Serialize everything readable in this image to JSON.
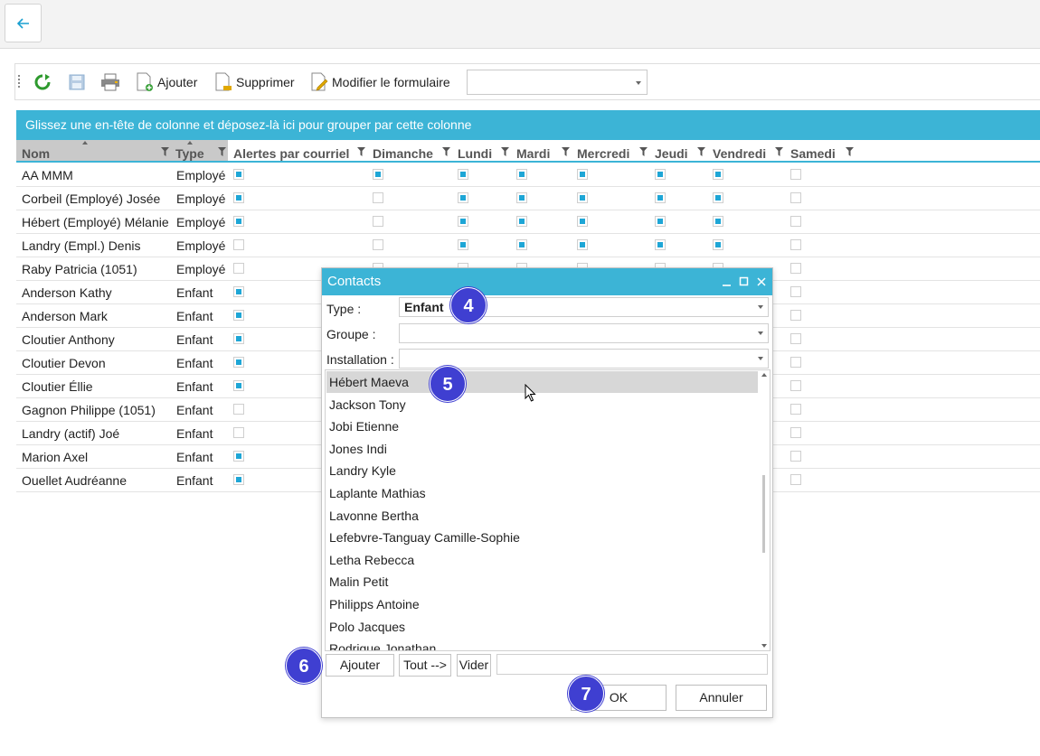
{
  "toolbar": {
    "add_label": "Ajouter",
    "delete_label": "Supprimer",
    "edit_form_label": "Modifier le formulaire",
    "combo_value": ""
  },
  "grid": {
    "group_hint": "Glissez une en-tête de colonne et déposez-là ici pour grouper par cette colonne",
    "columns": [
      "Nom",
      "Type",
      "Alertes par courriel",
      "Dimanche",
      "Lundi",
      "Mardi",
      "Mercredi",
      "Jeudi",
      "Vendredi",
      "Samedi"
    ],
    "rows": [
      {
        "name": "AA MMM",
        "type": "Employé",
        "checks": [
          true,
          true,
          true,
          true,
          true,
          true,
          true,
          false
        ]
      },
      {
        "name": "Corbeil (Employé) Josée",
        "type": "Employé",
        "checks": [
          true,
          false,
          true,
          true,
          true,
          true,
          true,
          false
        ]
      },
      {
        "name": "Hébert (Employé) Mélanie",
        "type": "Employé",
        "checks": [
          true,
          false,
          true,
          true,
          true,
          true,
          true,
          false
        ]
      },
      {
        "name": "Landry (Empl.) Denis",
        "type": "Employé",
        "checks": [
          false,
          false,
          true,
          true,
          true,
          true,
          true,
          false
        ]
      },
      {
        "name": "Raby Patricia (1051)",
        "type": "Employé",
        "checks": [
          false,
          false,
          false,
          false,
          false,
          false,
          false,
          false
        ]
      },
      {
        "name": "Anderson Kathy",
        "type": "Enfant",
        "checks": [
          true,
          false,
          false,
          false,
          false,
          false,
          false,
          false
        ]
      },
      {
        "name": "Anderson Mark",
        "type": "Enfant",
        "checks": [
          true,
          false,
          false,
          false,
          false,
          false,
          false,
          false
        ]
      },
      {
        "name": "Cloutier Anthony",
        "type": "Enfant",
        "checks": [
          true,
          false,
          false,
          false,
          false,
          false,
          false,
          false
        ]
      },
      {
        "name": "Cloutier Devon",
        "type": "Enfant",
        "checks": [
          true,
          false,
          false,
          false,
          false,
          false,
          false,
          false
        ]
      },
      {
        "name": "Cloutier Éllie",
        "type": "Enfant",
        "checks": [
          true,
          false,
          false,
          false,
          false,
          false,
          false,
          false
        ]
      },
      {
        "name": "Gagnon Philippe (1051)",
        "type": "Enfant",
        "checks": [
          false,
          false,
          false,
          false,
          false,
          false,
          false,
          false
        ]
      },
      {
        "name": "Landry (actif) Joé",
        "type": "Enfant",
        "checks": [
          false,
          false,
          false,
          false,
          false,
          false,
          false,
          false
        ]
      },
      {
        "name": "Marion Axel",
        "type": "Enfant",
        "checks": [
          true,
          false,
          false,
          false,
          false,
          false,
          false,
          false
        ]
      },
      {
        "name": "Ouellet Audréanne",
        "type": "Enfant",
        "checks": [
          true,
          false,
          false,
          false,
          false,
          false,
          false,
          false
        ]
      }
    ]
  },
  "dialog": {
    "title": "Contacts",
    "type_label": "Type :",
    "type_value": "Enfant",
    "group_label": "Groupe :",
    "group_value": "",
    "facility_label": "Installation :",
    "facility_value": "",
    "list_items": [
      "Hébert Maeva",
      "Jackson Tony",
      "Jobi Etienne",
      "Jones Indi",
      "Landry Kyle",
      "Laplante Mathias",
      "Lavonne Bertha",
      "Lefebvre-Tanguay Camille-Sophie",
      "Letha Rebecca",
      "Malin Petit",
      "Philipps Antoine",
      "Polo Jacques",
      "Rodrigue Jonathan"
    ],
    "selected_item": "Hébert Maeva",
    "add_button": "Ajouter",
    "all_button": "Tout -->",
    "clear_button": "Vider",
    "text_value": "",
    "ok_button": "OK",
    "cancel_button": "Annuler"
  },
  "callouts": [
    "4",
    "5",
    "6",
    "7"
  ],
  "colors": {
    "accent": "#3cb4d6",
    "check": "#1ea6d6",
    "badge": "#3f3fd1"
  }
}
